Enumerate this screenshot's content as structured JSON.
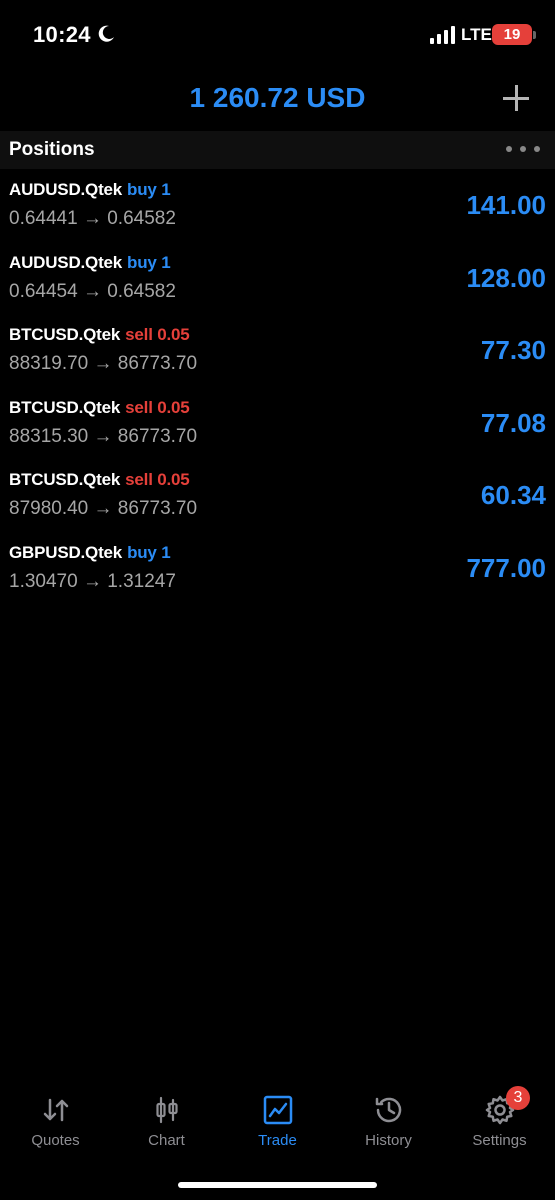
{
  "status_bar": {
    "time": "10:24",
    "network": "LTE",
    "battery": "19"
  },
  "header": {
    "balance": "1 260.72 USD"
  },
  "positions_section": {
    "title": "Positions"
  },
  "positions": [
    {
      "symbol": "AUDUSD.Qtek",
      "side": "buy 1",
      "side_type": "buy",
      "prices": "0.64441 → 0.64582",
      "profit": "141.00"
    },
    {
      "symbol": "AUDUSD.Qtek",
      "side": "buy 1",
      "side_type": "buy",
      "prices": "0.64454 → 0.64582",
      "profit": "128.00"
    },
    {
      "symbol": "BTCUSD.Qtek",
      "side": "sell 0.05",
      "side_type": "sell",
      "prices": "88319.70 → 86773.70",
      "profit": "77.30"
    },
    {
      "symbol": "BTCUSD.Qtek",
      "side": "sell 0.05",
      "side_type": "sell",
      "prices": "88315.30 → 86773.70",
      "profit": "77.08"
    },
    {
      "symbol": "BTCUSD.Qtek",
      "side": "sell 0.05",
      "side_type": "sell",
      "prices": "87980.40 → 86773.70",
      "profit": "60.34"
    },
    {
      "symbol": "GBPUSD.Qtek",
      "side": "buy 1",
      "side_type": "buy",
      "prices": "1.30470 → 1.31247",
      "profit": "777.00"
    }
  ],
  "tabs": [
    {
      "label": "Quotes",
      "icon": "quotes-arrows-icon"
    },
    {
      "label": "Chart",
      "icon": "candlestick-icon"
    },
    {
      "label": "Trade",
      "icon": "trade-chart-icon",
      "active": true
    },
    {
      "label": "History",
      "icon": "history-clock-icon"
    },
    {
      "label": "Settings",
      "icon": "gear-icon",
      "badge": "3"
    }
  ],
  "colors": {
    "accent": "#2b8cf5",
    "sell": "#e5403a",
    "muted": "#8e8e93",
    "background": "#000000"
  }
}
